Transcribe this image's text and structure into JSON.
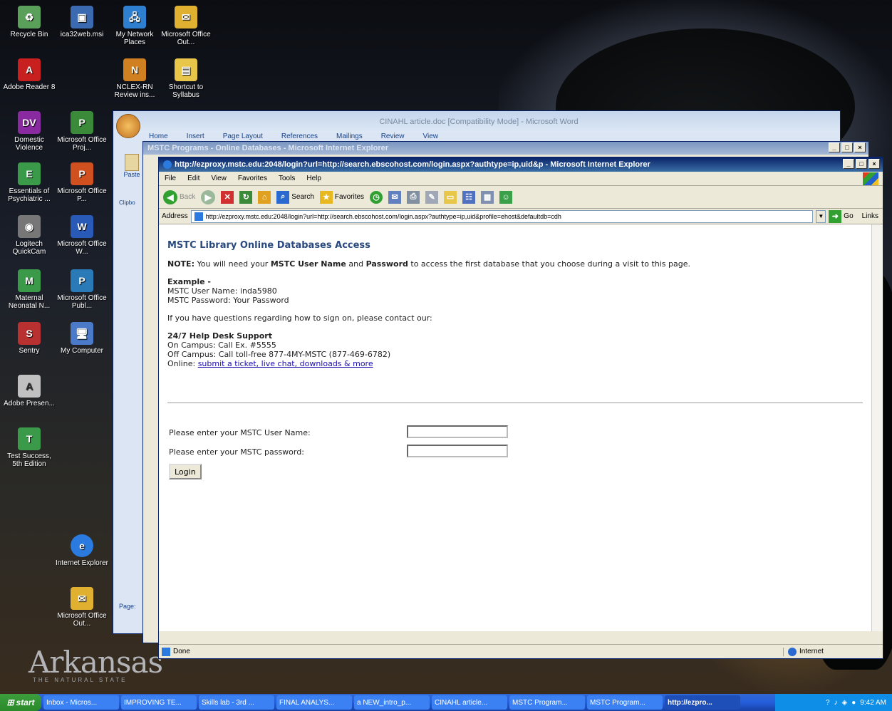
{
  "desktop": {
    "icons": [
      {
        "label": "Recycle Bin"
      },
      {
        "label": "ica32web.msi"
      },
      {
        "label": "My Network Places"
      },
      {
        "label": "Microsoft Office Out..."
      },
      {
        "label": "Adobe Reader 8"
      },
      {
        "label": "NCLEX-RN Review ins..."
      },
      {
        "label": "Shortcut to Syllabus"
      },
      {
        "label": "Domestic Violence"
      },
      {
        "label": "Microsoft Office Proj..."
      },
      {
        "label": "Essentials of Psychiatric ..."
      },
      {
        "label": "Microsoft Office P..."
      },
      {
        "label": "Logitech QuickCam"
      },
      {
        "label": "Microsoft Office W..."
      },
      {
        "label": "Maternal Neonatal N..."
      },
      {
        "label": "Microsoft Office Publ..."
      },
      {
        "label": "Sentry"
      },
      {
        "label": "My Computer"
      },
      {
        "label": "Adobe Presen..."
      },
      {
        "label": "Test Success, 5th Edition"
      },
      {
        "label": "Internet Explorer"
      },
      {
        "label": "Microsoft Office Out..."
      }
    ],
    "wallpaper_brand": "Arkansas",
    "wallpaper_tagline": "THE NATURAL STATE"
  },
  "word_window": {
    "title": "CINAHL article.doc [Compatibility Mode] - Microsoft Word",
    "tabs": [
      "Home",
      "Insert",
      "Page Layout",
      "References",
      "Mailings",
      "Review",
      "View"
    ],
    "paste_label": "Paste",
    "clipboard_label": "Clipbo",
    "status_label": "Page:"
  },
  "ie_back_window": {
    "title": "MSTC Programs - Online Databases - Microsoft Internet Explorer"
  },
  "ie_window": {
    "title": "http://ezproxy.mstc.edu:2048/login?url=http://search.ebscohost.com/login.aspx?authtype=ip,uid&p - Microsoft Internet Explorer",
    "menu": [
      "File",
      "Edit",
      "View",
      "Favorites",
      "Tools",
      "Help"
    ],
    "toolbar": {
      "back": "Back",
      "search": "Search",
      "favorites": "Favorites"
    },
    "address_label": "Address",
    "address_value": "http://ezproxy.mstc.edu:2048/login?url=http://search.ebscohost.com/login.aspx?authtype=ip,uid&profile=ehost&defaultdb=cdh",
    "go_label": "Go",
    "links_label": "Links",
    "status_text": "Done",
    "zone_text": "Internet"
  },
  "page": {
    "heading": "MSTC Library Online Databases Access",
    "note_label": "NOTE:",
    "note_text_1": "You will need your",
    "note_bold_1": "MSTC User Name",
    "note_text_2": "and",
    "note_bold_2": "Password",
    "note_text_3": "to access the first database that you choose during a visit to this page.",
    "example_label": "Example -",
    "example_user": "MSTC User Name: inda5980",
    "example_pass": "MSTC Password: Your Password",
    "questions": "If you have questions regarding how to sign on, please contact our:",
    "help_title": "24/7 Help Desk Support",
    "on_campus": "On Campus: Call Ex. #5555",
    "off_campus": "Off Campus: Call toll-free 877-4MY-MSTC (877-469-6782)",
    "online_label": "Online:",
    "online_link": "submit a ticket, live chat, downloads & more",
    "username_label": "Please enter your MSTC User Name:",
    "password_label": "Please enter your MSTC password:",
    "username_value": "",
    "password_value": "",
    "login_button": "Login"
  },
  "taskbar": {
    "start_label": "start",
    "tasks": [
      {
        "label": "Inbox - Micros..."
      },
      {
        "label": "IMPROVING TE..."
      },
      {
        "label": "Skills lab - 3rd ..."
      },
      {
        "label": "FINAL ANALYS..."
      },
      {
        "label": "a NEW_intro_p..."
      },
      {
        "label": "CINAHL article..."
      },
      {
        "label": "MSTC Program..."
      },
      {
        "label": "MSTC Program..."
      },
      {
        "label": "http://ezpro..."
      }
    ],
    "clock": "9:42 AM"
  },
  "colors": {
    "xp_blue": "#0a246a",
    "heading_blue": "#2a4a7f",
    "link": "#1a0dab"
  }
}
